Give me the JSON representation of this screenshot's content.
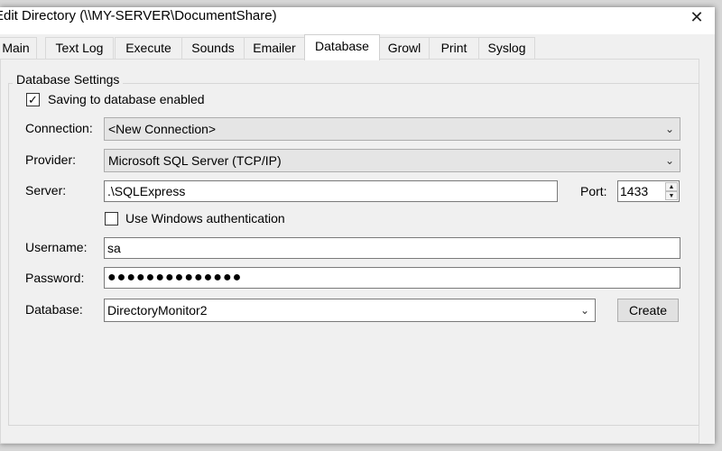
{
  "window": {
    "title": "Edit Directory (\\\\MY-SERVER\\DocumentShare)",
    "close_glyph": "✕"
  },
  "tabs": [
    {
      "label": "Main"
    },
    {
      "label": "Text Log"
    },
    {
      "label": "Execute"
    },
    {
      "label": "Sounds"
    },
    {
      "label": "Emailer"
    },
    {
      "label": "Database"
    },
    {
      "label": "Growl"
    },
    {
      "label": "Print"
    },
    {
      "label": "Syslog"
    }
  ],
  "active_tab": "Database",
  "group": {
    "label": "Database Settings"
  },
  "saving_enabled": {
    "label": "Saving to database enabled",
    "checked": true,
    "glyph": "✓"
  },
  "connection": {
    "label": "Connection:",
    "value": "<New Connection>"
  },
  "provider": {
    "label": "Provider:",
    "value": "Microsoft SQL Server (TCP/IP)"
  },
  "server": {
    "label": "Server:",
    "value": ".\\SQLExpress"
  },
  "port": {
    "label": "Port:",
    "value": "1433"
  },
  "windows_auth": {
    "label": "Use Windows authentication",
    "checked": false
  },
  "username": {
    "label": "Username:",
    "value": "sa"
  },
  "password": {
    "label": "Password:",
    "value": "●●●●●●●●●●●●●●"
  },
  "database": {
    "label": "Database:",
    "value": "DirectoryMonitor2"
  },
  "create_button": {
    "label": "Create"
  },
  "icons": {
    "dropdown": "chevron-down-icon",
    "close": "close-icon",
    "check": "checkmark-icon"
  }
}
